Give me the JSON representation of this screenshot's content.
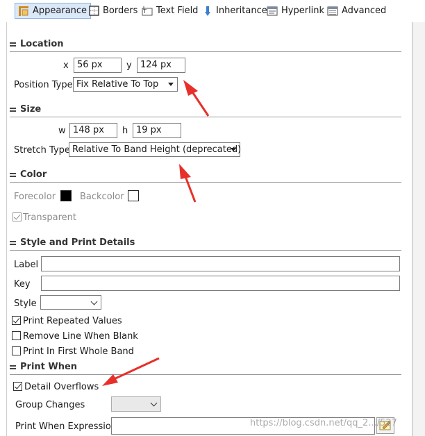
{
  "tabs": [
    {
      "label": "Appearance",
      "icon": "appearance-icon"
    },
    {
      "label": "Borders",
      "icon": "borders-icon"
    },
    {
      "label": "Text Field",
      "icon": "text-field-icon"
    },
    {
      "label": "Inheritance",
      "icon": "inheritance-icon"
    },
    {
      "label": "Hyperlink",
      "icon": "hyperlink-icon"
    },
    {
      "label": "Advanced",
      "icon": "advanced-icon"
    }
  ],
  "location": {
    "title": "Location",
    "x_label": "x",
    "x_value": "56 px",
    "y_label": "y",
    "y_value": "124 px",
    "position_type_label": "Position Type",
    "position_type_value": "Fix Relative To Top"
  },
  "size": {
    "title": "Size",
    "w_label": "w",
    "w_value": "148 px",
    "h_label": "h",
    "h_value": "19 px",
    "stretch_type_label": "Stretch Type",
    "stretch_type_value": "Relative To Band Height (deprecated)"
  },
  "color": {
    "title": "Color",
    "forecolor_label": "Forecolor",
    "forecolor": "#000000",
    "backcolor_label": "Backcolor",
    "backcolor": "#ffffff",
    "transparent_label": "Transparent",
    "transparent_checked": true
  },
  "style_print": {
    "title": "Style and Print Details",
    "label_label": "Label",
    "label_value": "",
    "key_label": "Key",
    "key_value": "",
    "style_label": "Style",
    "style_value": "",
    "print_repeated_label": "Print Repeated Values",
    "print_repeated_checked": true,
    "remove_line_label": "Remove Line When Blank",
    "remove_line_checked": false,
    "print_first_label": "Print In First Whole Band",
    "print_first_checked": false
  },
  "print_when": {
    "title": "Print When",
    "detail_overflows_label": "Detail Overflows",
    "detail_overflows_checked": true,
    "group_changes_label": "Group Changes",
    "group_changes_value": "",
    "expression_label": "Print When Expression",
    "expression_value": ""
  },
  "watermark": "https://blog.csdn.net/qq_2.../527",
  "colors": {
    "annotation_arrow": "#e8302a",
    "active_tab_bg": "#dbe8f8"
  }
}
